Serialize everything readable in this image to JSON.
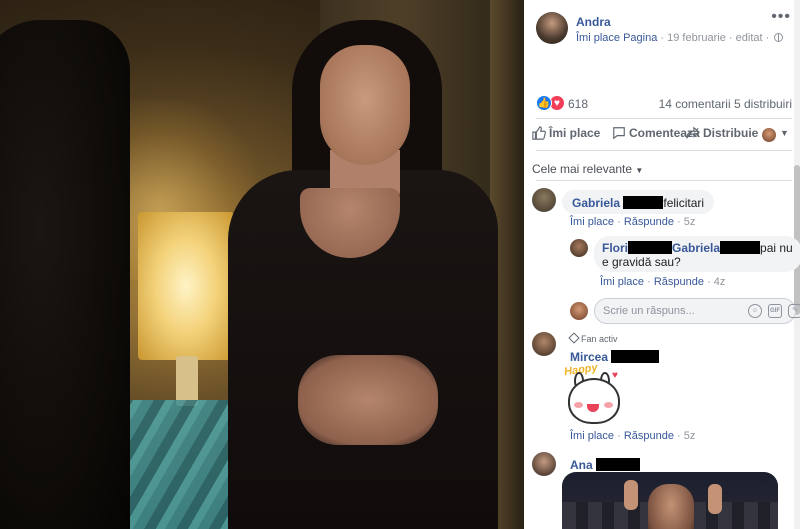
{
  "post": {
    "author": "Andra",
    "like_page": "Îmi place Pagina",
    "date": "19 februarie",
    "edited": "editat",
    "separator": "·"
  },
  "reactions": {
    "count": "618",
    "comments": "14 comentarii",
    "shares": "5 distribuiri"
  },
  "actions": {
    "like": "Îmi place",
    "comment": "Comentează",
    "share": "Distribuie"
  },
  "sort": {
    "label": "Cele mai relevante"
  },
  "comments": [
    {
      "name": "Gabriela",
      "text": "felicitari",
      "like": "Îmi place",
      "reply": "Răspunde",
      "time": "5z"
    },
    {
      "name": "Flori",
      "mention": "Gabriela",
      "text": "pai nu e gravidă sau?",
      "like": "Îmi place",
      "reply": "Răspunde",
      "time": "4z"
    },
    {
      "badge": "Fan activ",
      "name": "Mircea",
      "sticker_text": "Happy",
      "like": "Îmi place",
      "reply": "Răspunde",
      "time": "5z"
    },
    {
      "name": "Ana"
    }
  ],
  "reply_box": {
    "placeholder": "Scrie un răspuns..."
  },
  "icons": [
    "more-icon",
    "globe-icon",
    "like-reaction-icon",
    "love-reaction-icon",
    "thumbs-up-icon",
    "comment-icon",
    "share-icon",
    "emoji-icon",
    "gif-icon",
    "sticker-icon",
    "diamond-icon"
  ],
  "colors": {
    "link": "#385898",
    "like_blue": "#1877f2",
    "love_red": "#f33e58",
    "bubble_bg": "#f2f3f5",
    "muted": "#90949c"
  }
}
